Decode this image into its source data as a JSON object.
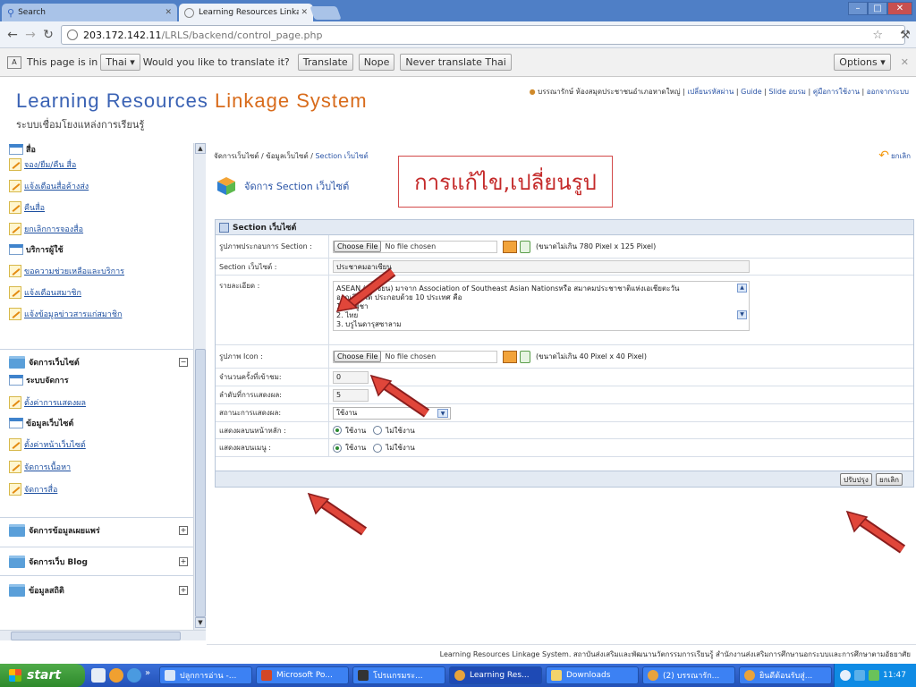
{
  "browser": {
    "tabs": [
      {
        "label": "Search",
        "active": false
      },
      {
        "label": "Learning Resources Linkage Sy",
        "active": true
      }
    ],
    "url_host": "203.172.142.11",
    "url_path": "/LRLS/backend/control_page.php",
    "translate_bar": {
      "text_pre": "This page is in",
      "language": "Thai",
      "text_post": "Would you like to translate it?",
      "translate_label": "Translate",
      "nope_label": "Nope",
      "never_label": "Never translate Thai",
      "options_label": "Options"
    }
  },
  "header": {
    "title_word1": "Learning Resources",
    "title_word2": "Linkage System",
    "subtitle": "ระบบเชื่อมโยงแหล่งการเรียนรู้",
    "user": "บรรณารักษ์ ห้องสมุดประชาชนอำเภอหาดใหญ่",
    "links": [
      "เปลี่ยนรหัสผ่าน",
      "Guide",
      "Slide อบรม",
      "คู่มือการใช้งาน",
      "ออกจากระบบ"
    ]
  },
  "sidebar": {
    "top_partial": "สื่อ",
    "items": [
      {
        "label": "จอง/ยืม/คืน สื่อ",
        "type": "link"
      },
      {
        "label": "แจ้งเตือนสื่อค้างส่ง",
        "type": "link"
      },
      {
        "label": "คืนสื่อ",
        "type": "link"
      },
      {
        "label": "ยกเลิกการจองสื่อ",
        "type": "link"
      },
      {
        "label": "บริการผู้ใช้",
        "type": "section"
      },
      {
        "label": "ขอความช่วยเหลือและบริการ",
        "type": "link"
      },
      {
        "label": "แจ้งเตือนสมาชิก",
        "type": "link"
      },
      {
        "label": "แจ้งข้อมูลข่าวสารแก่สมาชิก",
        "type": "link"
      }
    ],
    "group_manage_site": "จัดการเว็บไซต์",
    "manage_items": [
      {
        "label": "ระบบจัดการ",
        "type": "section"
      },
      {
        "label": "ตั้งค่าการแสดงผล",
        "type": "link"
      },
      {
        "label": "ข้อมูลเว็บไซต์",
        "type": "section"
      },
      {
        "label": "ตั้งค่าหน้าเว็บไซต์",
        "type": "link"
      },
      {
        "label": "จัดการเนื้อหา",
        "type": "link"
      },
      {
        "label": "จัดการสื่อ",
        "type": "link"
      }
    ],
    "groups_collapsed": [
      "จัดการข้อมูลเผยแพร่",
      "จัดการเว็บ Blog",
      "ข้อมูลสถิติ"
    ]
  },
  "main": {
    "breadcrumb_1": "จัดการเว็บไซต์",
    "breadcrumb_2": "ข้อมูลเว็บไซต์",
    "breadcrumb_current": "Section เว็บไซต์",
    "back_label": "ยกเลิก",
    "page_title": "จัดการ Section เว็บไซต์",
    "annotation": "การแก้ไข,เปลี่ยนรูป",
    "panel_title": "Section เว็บไซต์",
    "form": {
      "banner_label": "รูปภาพประกอบการ Section :",
      "choose_file": "Choose File",
      "no_file": "No file chosen",
      "banner_hint": "(ขนาดไม่เกิน 780 Pixel x 125 Pixel)",
      "section_label": "Section เว็บไซต์ :",
      "section_value": "ประชาคมอาเซียน",
      "detail_label": "รายละเอียด :",
      "detail_lines": [
        "ASEAN (อาเซียน) มาจาก Association of Southeast Asian Nationsหรือ สมาคมประชาชาติแห่งเอเชียตะวัน",
        "ออกเฉียงใต้  ประกอบด้วย 10 ประเทศ คือ",
        "1. กัมพูชา",
        "2. ไทย",
        "3. บรูไนดารุสซาลาม"
      ],
      "icon_label": "รูปภาพ Icon :",
      "icon_hint": "(ขนาดไม่เกิน 40 Pixel x 40 Pixel)",
      "visits_label": "จำนวนครั้งที่เข้าชม:",
      "visits_value": "0",
      "order_label": "ลำดับที่การแสดงผล:",
      "order_value": "5",
      "status_label": "สถานะการแสดงผล:",
      "status_value": "ใช้งาน",
      "home_label": "แสดงผลบนหน้าหลัก :",
      "menu_label": "แสดงผลบนเมนู :",
      "opt_on": "ใช้งาน",
      "opt_off": "ไม่ใช้งาน",
      "save_label": "ปรับปรุง",
      "cancel_label": "ยกเลิก"
    }
  },
  "footer": "Learning Resources Linkage System. สถาบันส่งเสริมและพัฒนานวัตกรรมการเรียนรู้ สำนักงานส่งเสริมการศึกษานอกระบบและการศึกษาตามอัธยาศัย",
  "taskbar": {
    "start": "start",
    "tasks": [
      "ปลูกการอ่าน -...",
      "Microsoft Po...",
      "โปรแกรมระ...",
      "Learning Res...",
      "Downloads",
      "(2) บรรณารัก...",
      "ยินดีต้อนรับสู่..."
    ],
    "clock": "11:47"
  }
}
